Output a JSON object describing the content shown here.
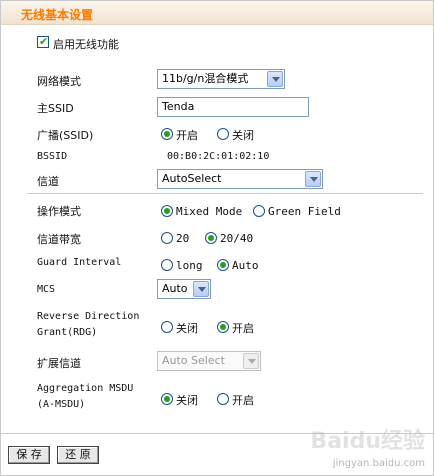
{
  "page": {
    "title": "无线基本设置"
  },
  "enable_wireless": {
    "label": "启用无线功能",
    "checked": true
  },
  "network_mode": {
    "label": "网络模式",
    "value": "11b/g/n混合模式"
  },
  "ssid": {
    "label": "主SSID",
    "value": "Tenda"
  },
  "broadcast": {
    "label": "广播(SSID)",
    "options": [
      "开启",
      "关闭"
    ],
    "selected": "开启"
  },
  "bssid": {
    "label": "BSSID",
    "value": "00:B0:2C:01:02:10"
  },
  "channel": {
    "label": "信道",
    "value": "AutoSelect"
  },
  "operation_mode": {
    "label": "操作模式",
    "options": [
      "Mixed Mode",
      "Green Field"
    ],
    "selected": "Mixed Mode"
  },
  "channel_bandwidth": {
    "label": "信道带宽",
    "options": [
      "20",
      "20/40"
    ],
    "selected": "20/40"
  },
  "guard_interval": {
    "label": "Guard Interval",
    "options": [
      "long",
      "Auto"
    ],
    "selected": "Auto"
  },
  "mcs": {
    "label": "MCS",
    "value": "Auto"
  },
  "rdg": {
    "label_line1": "Reverse Direction",
    "label_line2": "Grant(RDG)",
    "options": [
      "关闭",
      "开启"
    ],
    "selected": "开启"
  },
  "ext_channel": {
    "label": "扩展信道",
    "value": "Auto Select"
  },
  "amsdu": {
    "label_line1": "Aggregation MSDU",
    "label_line2": "(A-MSDU)",
    "options": [
      "关闭",
      "开启"
    ],
    "selected": "关闭"
  },
  "buttons": {
    "save": "保 存",
    "restore": "还 原"
  },
  "watermark": {
    "brand": "Baidu经验",
    "url": "jingyan.baidu.com"
  }
}
